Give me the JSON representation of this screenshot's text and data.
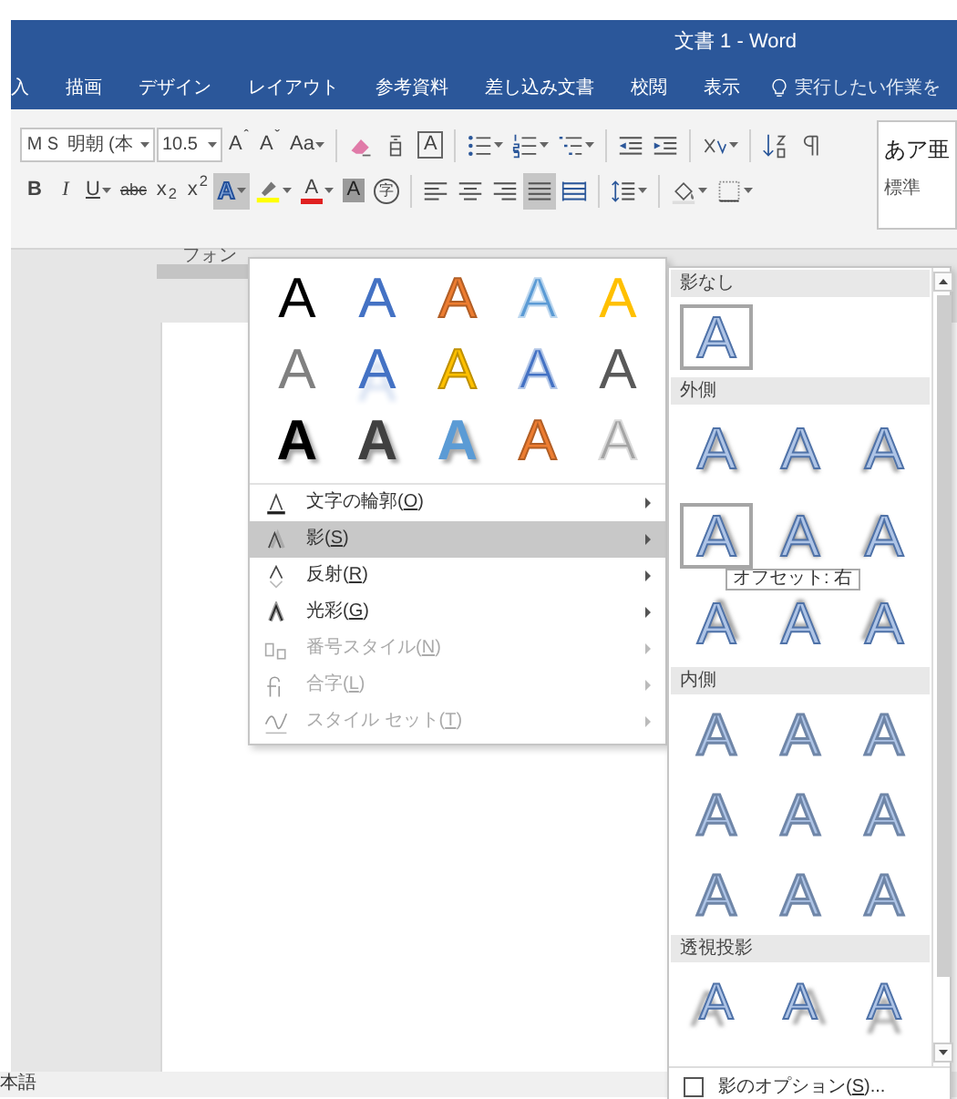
{
  "window": {
    "title": "文書 1 - Word"
  },
  "ribbon_tabs": [
    {
      "label": "入"
    },
    {
      "label": "描画"
    },
    {
      "label": "デザイン"
    },
    {
      "label": "レイアウト"
    },
    {
      "label": "参考資料"
    },
    {
      "label": "差し込み文書"
    },
    {
      "label": "校閲"
    },
    {
      "label": "表示"
    }
  ],
  "tell_me": {
    "placeholder": "実行したい作業を"
  },
  "toolbar_row_1": [
    {
      "kind": "combo",
      "label": "ＭＳ 明朝 (本"
    },
    {
      "kind": "combo",
      "label": "10.5"
    },
    {
      "kind": "text",
      "label": "A$^{ˆ}$"
    },
    {
      "kind": "text",
      "label": "A$^{ˇ}$"
    },
    {
      "kind": "text",
      "label": "Aa",
      "menu": true
    },
    {
      "kind": "sep"
    },
    {
      "kind": "icon"
    },
    {
      "kind": "icon"
    },
    {
      "kind": "boxed",
      "label": "A"
    },
    {
      "kind": "sep"
    },
    {
      "kind": "icon",
      "menu": true
    },
    {
      "kind": "icon",
      "menu": true
    },
    {
      "kind": "icon",
      "menu": true
    },
    {
      "kind": "sep"
    },
    {
      "kind": "icon"
    },
    {
      "kind": "icon"
    },
    {
      "kind": "sep"
    },
    {
      "kind": "icon",
      "menu": true
    },
    {
      "kind": "sep"
    },
    {
      "kind": "icon"
    },
    {
      "kind": "icon"
    }
  ],
  "toolbar_row_2": [
    {
      "kind": "bold",
      "label": "B"
    },
    {
      "kind": "italic",
      "label": "I"
    },
    {
      "kind": "underline",
      "label": "U",
      "menu": true
    },
    {
      "kind": "strike",
      "label": "abc"
    },
    {
      "kind": "text",
      "label": "x$_{2}$"
    },
    {
      "kind": "text",
      "label": "x$^{2}$"
    },
    {
      "kind": "effect",
      "label": "A",
      "menu": true,
      "selected": true
    },
    {
      "kind": "icon",
      "menu": true
    },
    {
      "kind": "color",
      "label": "A",
      "menu": true,
      "color": "#e02020"
    },
    {
      "kind": "shaded",
      "label": "A"
    },
    {
      "kind": "circled",
      "label": "字"
    },
    {
      "kind": "sep"
    },
    {
      "kind": "icon",
      "selected": false
    },
    {
      "kind": "icon",
      "selected": false
    },
    {
      "kind": "icon",
      "selected": false
    },
    {
      "kind": "icon",
      "selected": true
    },
    {
      "kind": "icon",
      "selected": false
    },
    {
      "kind": "sep"
    },
    {
      "kind": "icon",
      "menu": true
    },
    {
      "kind": "sep"
    },
    {
      "kind": "icon",
      "menu": true
    },
    {
      "kind": "icon",
      "menu": true
    }
  ],
  "styles_gallery": {
    "sample": "あア亜",
    "name": "標準"
  },
  "group_label": "フォン",
  "text_effects": {
    "samples": [
      {
        "glyph": "A",
        "kind": "solid",
        "color": "#000000"
      },
      {
        "glyph": "A",
        "kind": "solid",
        "color": "#4472c4"
      },
      {
        "glyph": "A",
        "kind": "soft",
        "color": "#ed7d31"
      },
      {
        "glyph": "A",
        "kind": "outline",
        "color": "#5b9bd5"
      },
      {
        "glyph": "A",
        "kind": "solid",
        "color": "#ffc000"
      },
      {
        "glyph": "A",
        "kind": "solid",
        "color": "#808080"
      },
      {
        "glyph": "A",
        "kind": "reflect",
        "color": "#4472c4"
      },
      {
        "glyph": "A",
        "kind": "soft",
        "color": "#ffc000"
      },
      {
        "glyph": "A",
        "kind": "outline",
        "color": "#4472c4"
      },
      {
        "glyph": "A",
        "kind": "solid",
        "color": "#595959"
      },
      {
        "glyph": "A",
        "kind": "bold",
        "color": "#000000"
      },
      {
        "glyph": "A",
        "kind": "bold",
        "color": "#404040"
      },
      {
        "glyph": "A",
        "kind": "bold",
        "color": "#5b9bd5"
      },
      {
        "glyph": "A",
        "kind": "soft",
        "color": "#ed7d31"
      },
      {
        "glyph": "A",
        "kind": "outline",
        "color": "#a5a5a5"
      }
    ],
    "items": [
      {
        "label": "文字の輪郭(O)",
        "selected": false,
        "disabled": false
      },
      {
        "label": "影(S)",
        "selected": true,
        "disabled": false
      },
      {
        "label": "反射(R)",
        "selected": false,
        "disabled": false
      },
      {
        "label": "光彩(G)",
        "selected": false,
        "disabled": false
      },
      {
        "label": "番号スタイル(N)",
        "selected": false,
        "disabled": true
      },
      {
        "label": "合字(L)",
        "selected": false,
        "disabled": true
      },
      {
        "label": "スタイル セット(T)",
        "selected": false,
        "disabled": true
      }
    ]
  },
  "shadow_menu": {
    "sections": [
      {
        "title": "影なし",
        "kind": "none",
        "presets": [
          {
            "glyph": "A",
            "selected": true
          }
        ]
      },
      {
        "title": "外側",
        "kind": "outer",
        "presets": [
          {
            "glyph": "A",
            "selected": false
          },
          {
            "glyph": "A",
            "selected": false
          },
          {
            "glyph": "A",
            "selected": false
          },
          {
            "glyph": "A",
            "selected": true,
            "tooltip": "オフセット: 右"
          },
          {
            "glyph": "A",
            "selected": false
          },
          {
            "glyph": "A",
            "selected": false
          },
          {
            "glyph": "A",
            "selected": false
          },
          {
            "glyph": "A",
            "selected": false
          },
          {
            "glyph": "A",
            "selected": false
          }
        ]
      },
      {
        "title": "内側",
        "kind": "inner",
        "presets": [
          {
            "glyph": "A",
            "selected": false
          },
          {
            "glyph": "A",
            "selected": false
          },
          {
            "glyph": "A",
            "selected": false
          },
          {
            "glyph": "A",
            "selected": false
          },
          {
            "glyph": "A",
            "selected": false
          },
          {
            "glyph": "A",
            "selected": false
          },
          {
            "glyph": "A",
            "selected": false
          },
          {
            "glyph": "A",
            "selected": false
          },
          {
            "glyph": "A",
            "selected": false
          }
        ]
      },
      {
        "title": "透視投影",
        "kind": "perspective",
        "presets": [
          {
            "glyph": "A",
            "selected": false
          },
          {
            "glyph": "A",
            "selected": false
          },
          {
            "glyph": "A",
            "selected": false
          }
        ]
      }
    ],
    "options": {
      "label": "影のオプション(S)...",
      "checked": false
    }
  },
  "status_bar": {
    "language": "本語"
  }
}
